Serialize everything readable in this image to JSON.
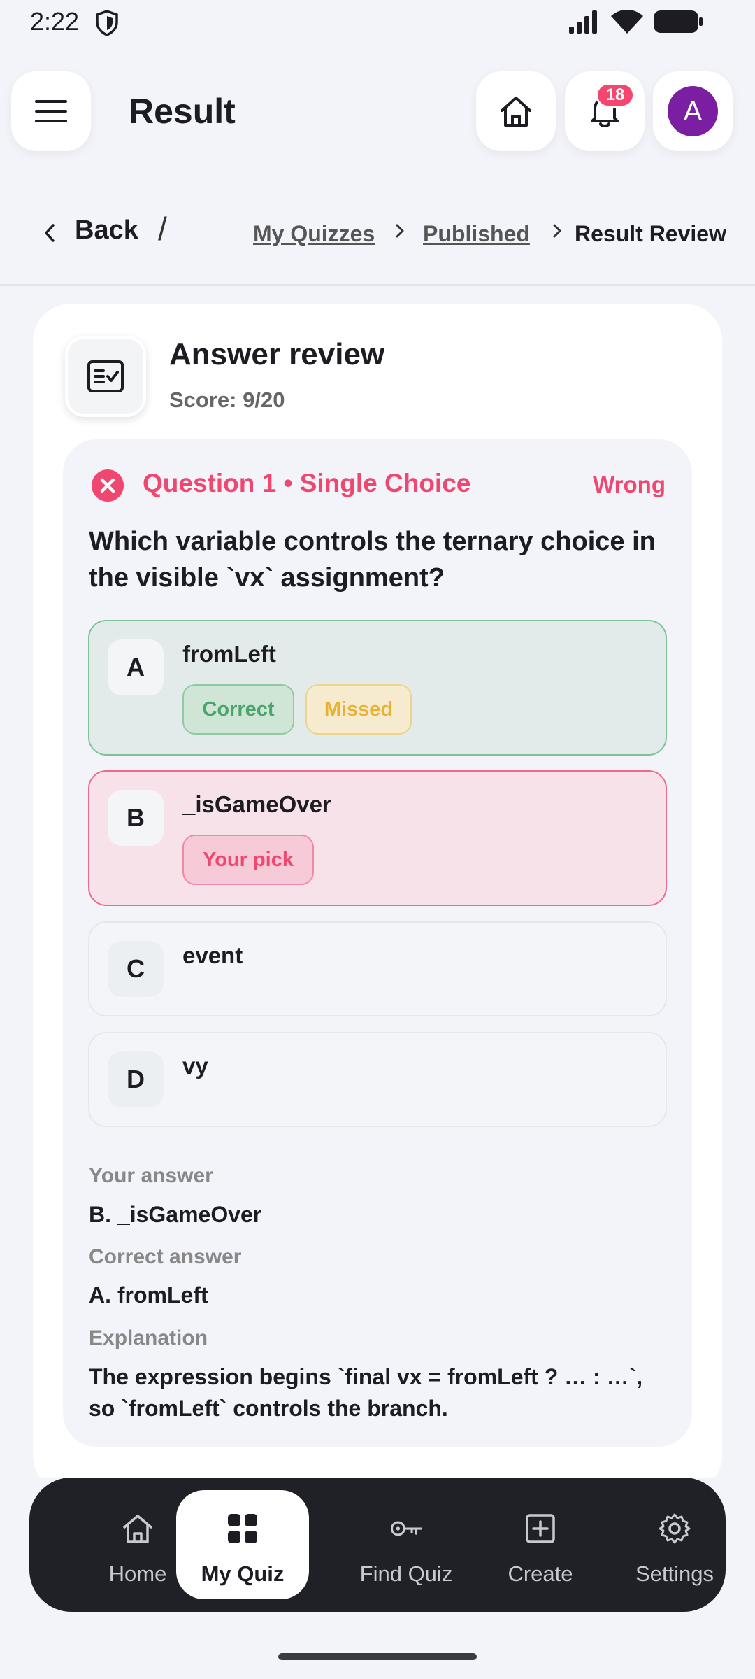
{
  "status_bar": {
    "time": "2:22",
    "icons": [
      "shield-icon",
      "signal-icon",
      "wifi-icon",
      "battery-icon"
    ]
  },
  "header": {
    "title": "Result",
    "notification_count": "18",
    "avatar_initial": "A",
    "avatar_color": "#7b1fa2"
  },
  "breadcrumb": {
    "back_label": "Back",
    "separator": "/",
    "items": [
      "My Quizzes",
      "Published"
    ],
    "current": "Result Review"
  },
  "review": {
    "title": "Answer review",
    "score": "Score: 9/20"
  },
  "question": {
    "header": "Question 1 • Single Choice",
    "status": "Wrong",
    "text": "Which variable controls the ternary choice in the visible `vx` assignment?",
    "options": [
      {
        "letter": "A",
        "text": "fromLeft",
        "tags": [
          "Correct",
          "Missed"
        ],
        "state": "correct"
      },
      {
        "letter": "B",
        "text": "_isGameOver",
        "tags": [
          "Your pick"
        ],
        "state": "picked-wrong"
      },
      {
        "letter": "C",
        "text": "event",
        "tags": [],
        "state": "neutral"
      },
      {
        "letter": "D",
        "text": "vy",
        "tags": [],
        "state": "neutral"
      }
    ],
    "your_answer_label": "Your answer",
    "your_answer": "B. _isGameOver",
    "correct_answer_label": "Correct answer",
    "correct_answer": "A. fromLeft",
    "explanation_label": "Explanation",
    "explanation": "The expression begins `final vx = fromLeft ? … : …`, so `fromLeft` controls the branch."
  },
  "bottom_nav": {
    "items": [
      {
        "label": "Home",
        "icon": "home-icon",
        "active": false
      },
      {
        "label": "My Quiz",
        "icon": "grid-icon",
        "active": true
      },
      {
        "label": "Find Quiz",
        "icon": "key-icon",
        "active": false
      },
      {
        "label": "Create",
        "icon": "plus-square-icon",
        "active": false
      },
      {
        "label": "Settings",
        "icon": "gear-icon",
        "active": false
      }
    ]
  },
  "colors": {
    "accent_wrong": "#f04770",
    "correct_green": "#4aa56a",
    "missed_yellow": "#e8b12f",
    "nav_bg": "#202127"
  }
}
